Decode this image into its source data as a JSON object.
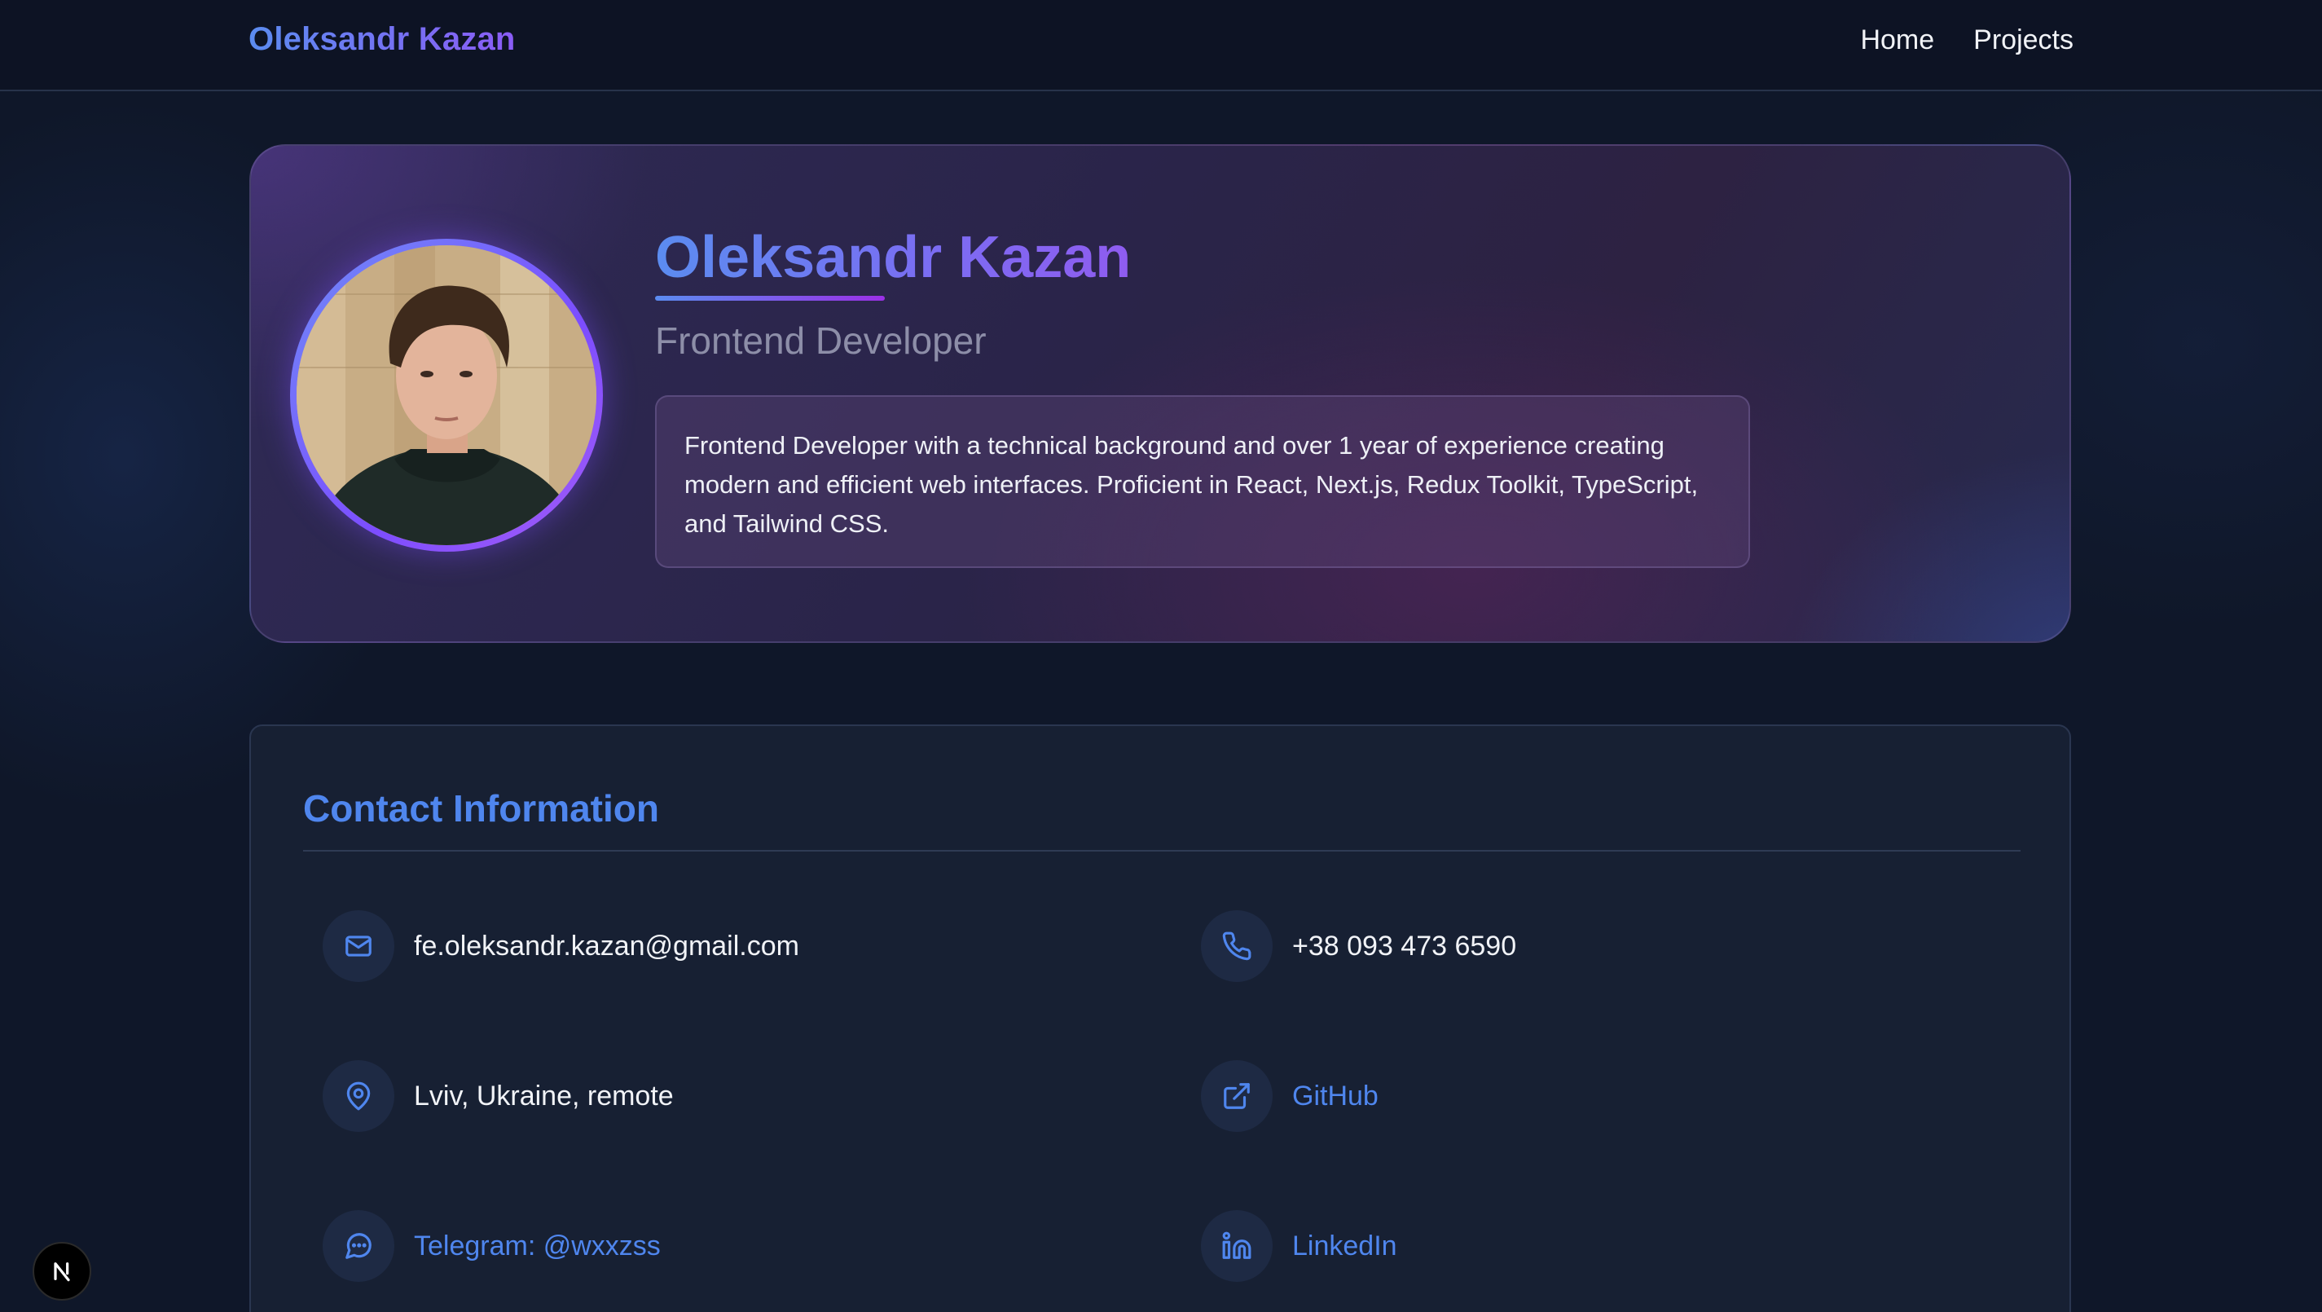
{
  "header": {
    "brand": "Oleksandr Kazan",
    "nav": [
      {
        "label": "Home"
      },
      {
        "label": "Projects"
      }
    ]
  },
  "hero": {
    "name": "Oleksandr Kazan",
    "role": "Frontend Developer",
    "bio": "Frontend Developer with a technical background and over 1 year of experience creating modern and efficient web interfaces. Proficient in React, Next.js, Redux Toolkit, TypeScript, and Tailwind CSS."
  },
  "contact": {
    "title": "Contact Information",
    "items": [
      {
        "icon": "mail-icon",
        "text": "fe.oleksandr.kazan@gmail.com",
        "link": false
      },
      {
        "icon": "phone-icon",
        "text": "+38 093 473 6590",
        "link": false
      },
      {
        "icon": "map-pin-icon",
        "text": "Lviv, Ukraine, remote",
        "link": false
      },
      {
        "icon": "external-link-icon",
        "text": "GitHub",
        "link": true
      },
      {
        "icon": "message-circle-icon",
        "text": "Telegram: @wxxzss",
        "link": true
      },
      {
        "icon": "linkedin-icon",
        "text": "LinkedIn",
        "link": true
      }
    ]
  },
  "colors": {
    "accent": "#4f86ee",
    "gradient_start": "#5b8cf0",
    "gradient_end": "#8b5cf6",
    "background": "#0f1729",
    "card": "#172033"
  },
  "badge": {
    "icon": "nextjs-icon"
  }
}
